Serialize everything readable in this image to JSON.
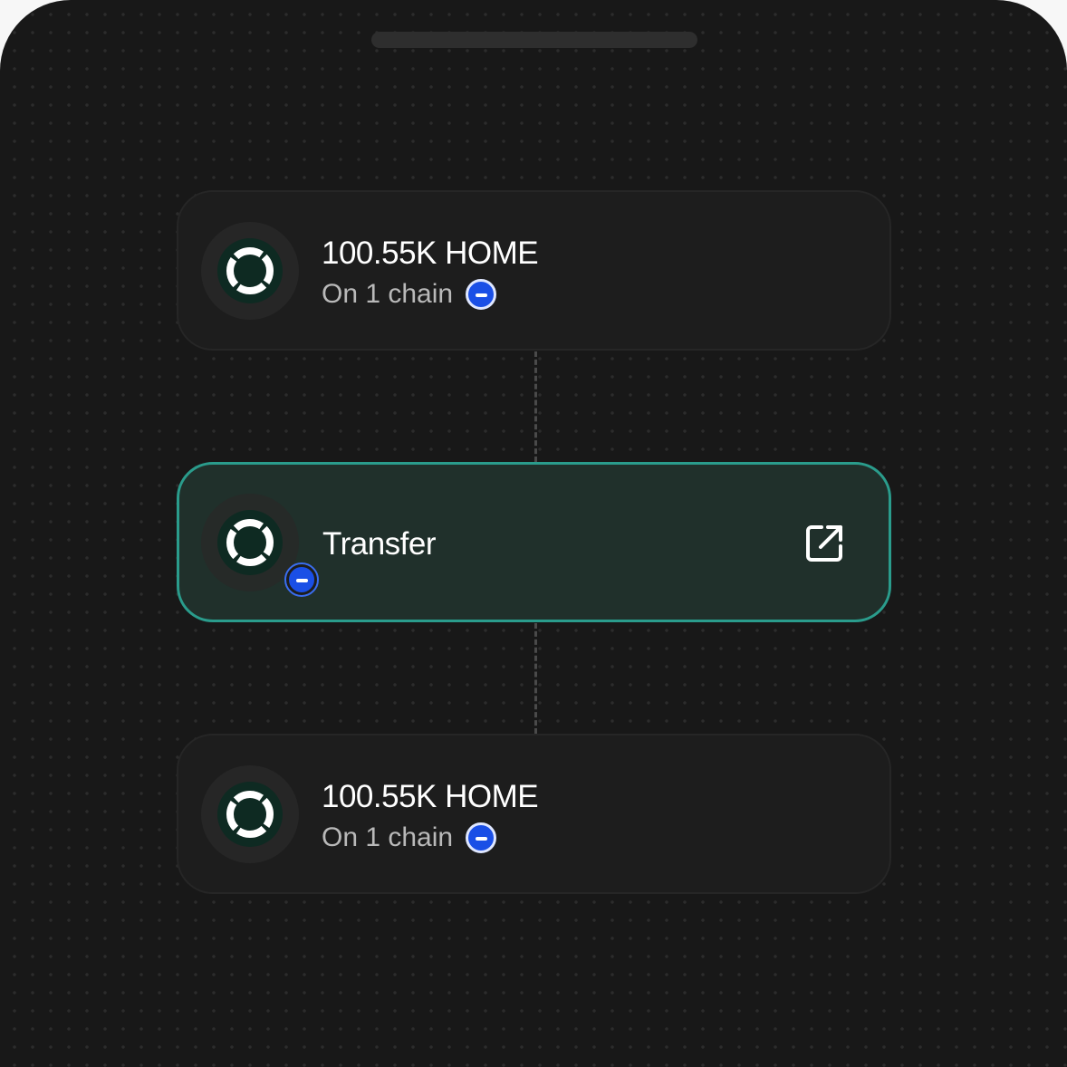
{
  "steps": [
    {
      "title": "100.55K HOME",
      "subtitle": "On 1 chain",
      "token_icon": "home-token-icon",
      "chain_icon": "chain-badge-icon"
    },
    {
      "title": "Transfer",
      "token_icon": "home-token-icon",
      "chain_icon": "chain-badge-icon",
      "action_icon": "external-link-icon",
      "highlighted": true
    },
    {
      "title": "100.55K HOME",
      "subtitle": "On 1 chain",
      "token_icon": "home-token-icon",
      "chain_icon": "chain-badge-icon"
    }
  ],
  "colors": {
    "background": "#181818",
    "card": "#1d1d1d",
    "highlight_card": "#20302b",
    "highlight_border": "#2a9c8c",
    "chain_badge": "#1a4fe6"
  }
}
